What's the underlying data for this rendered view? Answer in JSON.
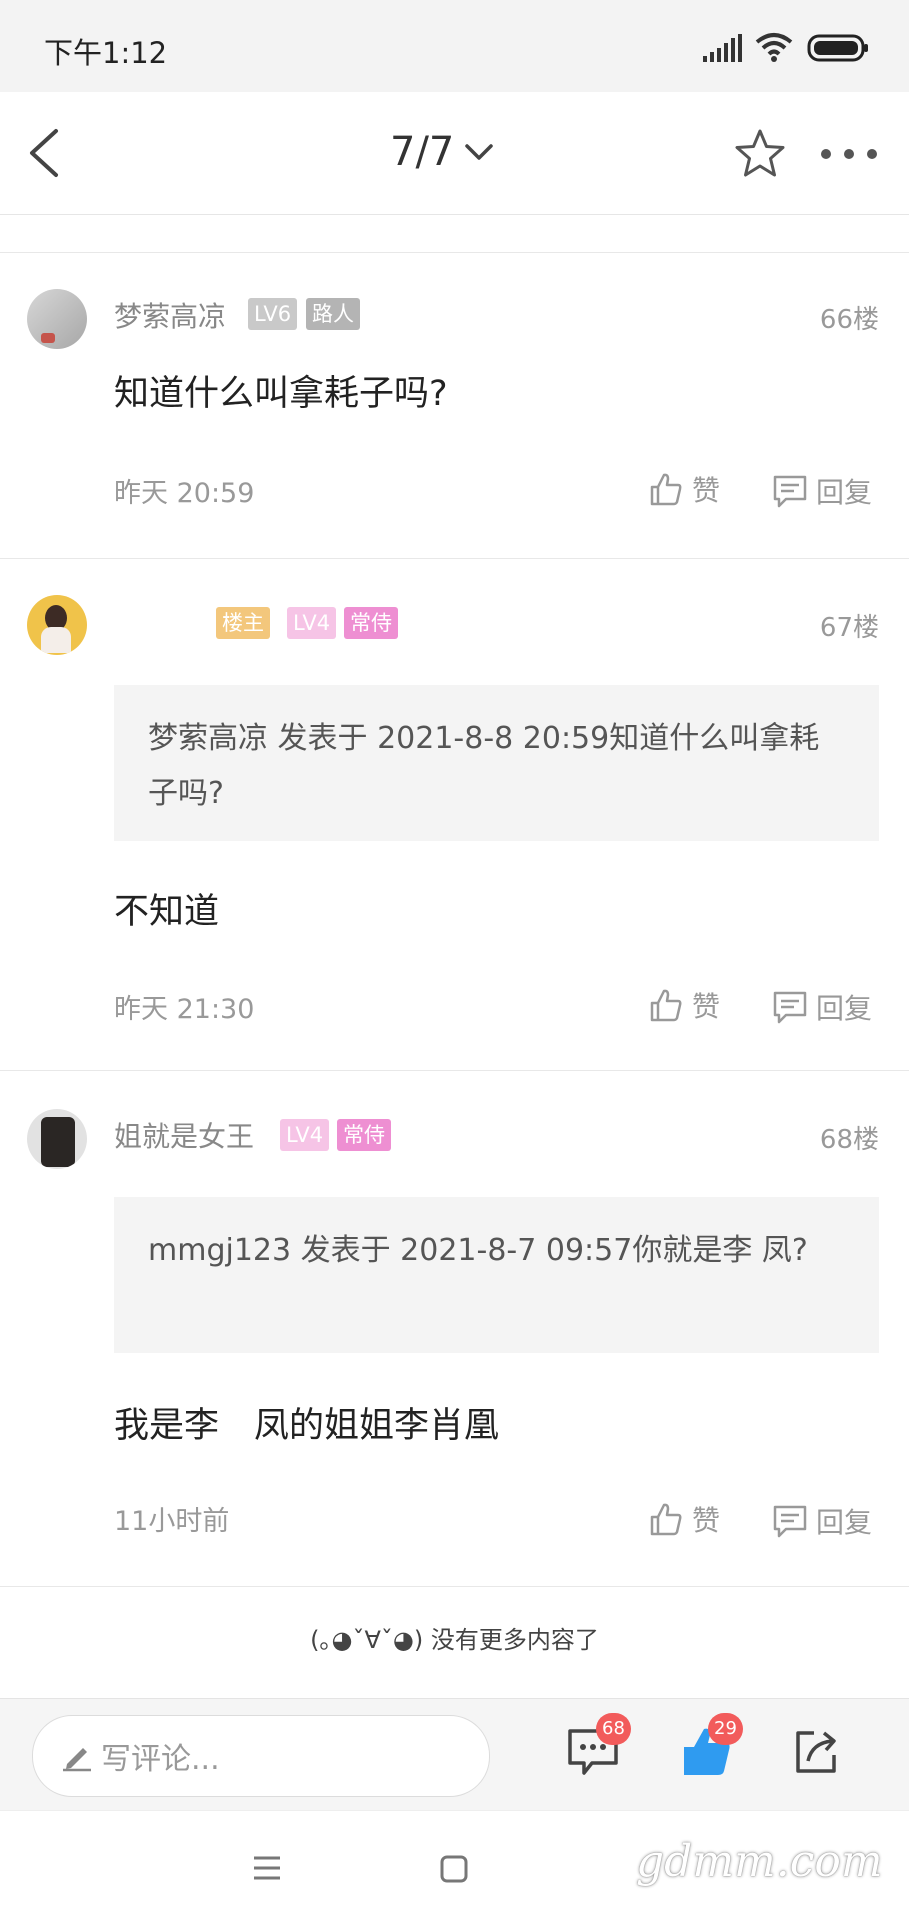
{
  "status_bar": {
    "time": "下午1:12"
  },
  "header": {
    "page_indicator": "7/7"
  },
  "posts": [
    {
      "username": "梦萦高凉",
      "badges": [
        {
          "text": "LV6",
          "bg": "#c9c9c9",
          "fg": "#ffffff"
        },
        {
          "text": "路人",
          "bg": "#b4b4b4",
          "fg": "#ffffff"
        }
      ],
      "floor": "66楼",
      "content": "知道什么叫拿耗子吗?",
      "time": "昨天 20:59",
      "like_label": "赞",
      "reply_label": "回复"
    },
    {
      "username": "",
      "badges": [
        {
          "text": "楼主",
          "bg": "#f3c77c",
          "fg": "#ffffff"
        },
        {
          "text": "LV4",
          "bg": "#f6c4e6",
          "fg": "#ffffff"
        },
        {
          "text": "常侍",
          "bg": "#ee8fd2",
          "fg": "#ffffff"
        }
      ],
      "floor": "67楼",
      "quote": "梦萦高凉 发表于 2021-8-8 20:59知道什么叫拿耗子吗?",
      "content": "不知道",
      "time": "昨天 21:30",
      "like_label": "赞",
      "reply_label": "回复"
    },
    {
      "username": "姐就是女王",
      "badges": [
        {
          "text": "LV4",
          "bg": "#f6c4e6",
          "fg": "#ffffff"
        },
        {
          "text": "常侍",
          "bg": "#ee8fd2",
          "fg": "#ffffff"
        }
      ],
      "floor": "68楼",
      "quote": "mmgj123 发表于 2021-8-7 09:57你就是李 凤?",
      "content": "我是李　凤的姐姐李肖凰",
      "time": "11小时前",
      "like_label": "赞",
      "reply_label": "回复"
    }
  ],
  "footer_note": "(｡◕ˇ∀ˇ◕) 没有更多内容了",
  "bottom_bar": {
    "comment_placeholder": "写评论...",
    "comment_count": "68",
    "like_count": "29"
  },
  "watermark": "gdmm.com",
  "colors": {
    "accent_blue": "#2f9bf0",
    "badge_red": "#f25b5b"
  }
}
